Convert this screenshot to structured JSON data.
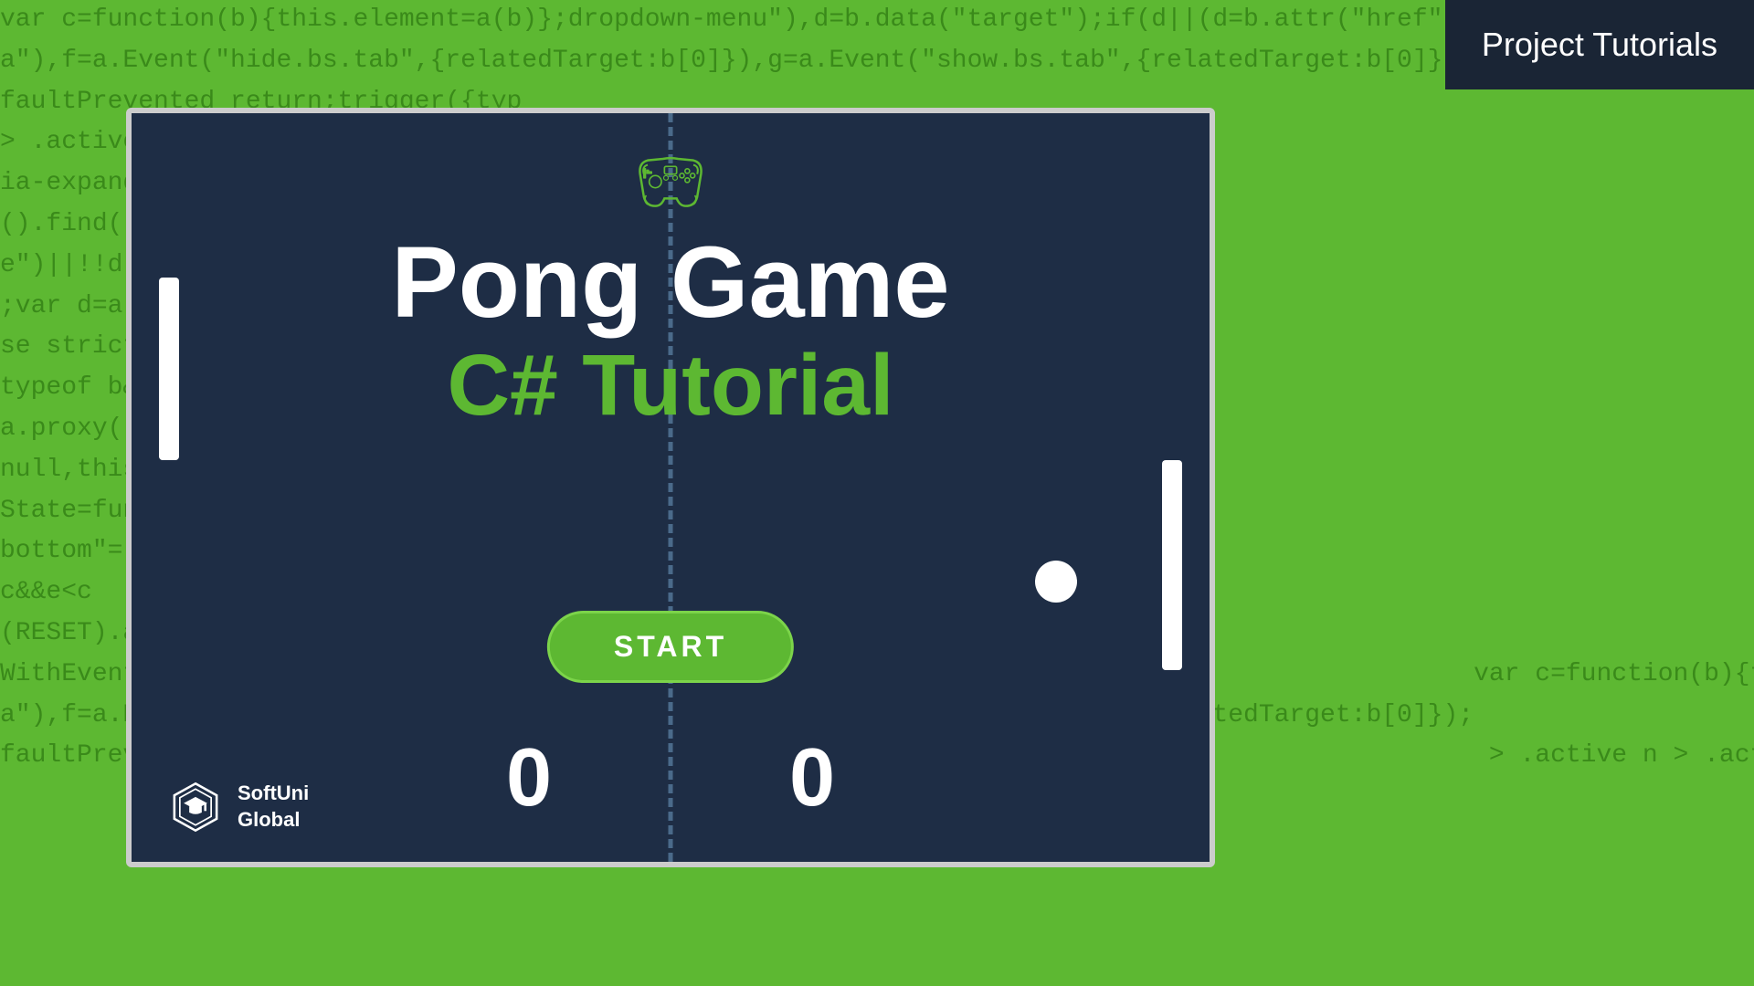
{
  "header": {
    "badge_label": "Project Tutorials",
    "badge_bg": "#1a2535"
  },
  "card": {
    "background": "#1e2d45",
    "border_color": "#d0cfc8"
  },
  "game": {
    "title": "Pong Game",
    "subtitle": "C# Tutorial",
    "start_button": "START",
    "score_left": "0",
    "score_right": "0"
  },
  "brand": {
    "name_line1": "SoftUni",
    "name_line2": "Global"
  },
  "code_background": {
    "color": "#5db832",
    "text_color": "#3a8a1a",
    "sample": "var c=function(b){this.element=a(b)};dropdown-menu\"),d=b.data(\"target\");if(d||(d=b.attr(\"href\"),d=d&&d.replace( *(?=#[^\\s]*$),\"\"))a\"),f=a.Event(\"hide.bs.tab\",{relatedTarget:b[0]}),g=a.Event(\"show.bs.tab\",{rela faultPrevented return;triggertyp > .active n > .activeia-expanded().find('[dState=funde|)||!d.f;var d=a.fse strict\"typeof b&&a.proxy(null,this.State=fundbottom\"=c&&e<c(RESET).adWithEventFun"
  }
}
